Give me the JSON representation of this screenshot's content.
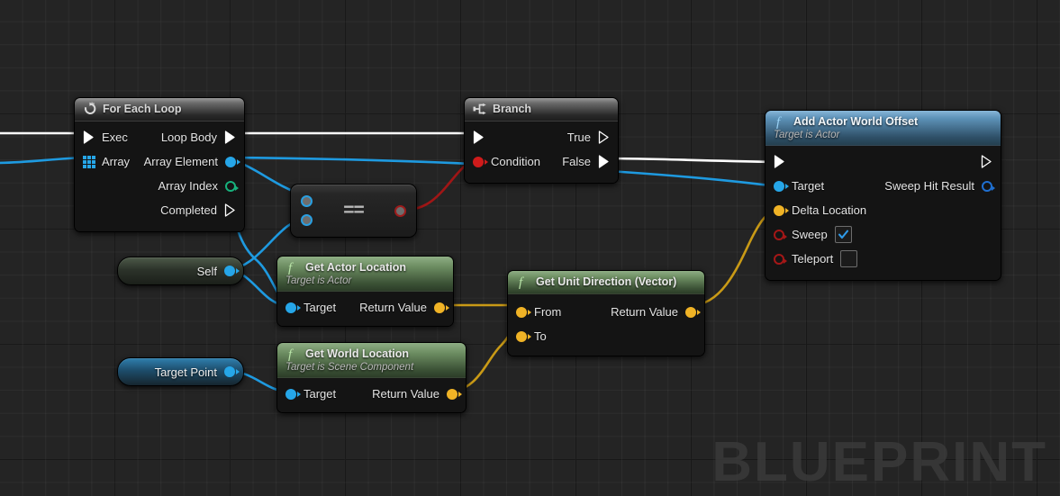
{
  "canvas": {
    "watermark": "BLUEPRINT",
    "background_color": "#242424",
    "grid_color": "#2e2e2e"
  },
  "colors": {
    "exec_white": "#ffffff",
    "object_blue": "#26a6e8",
    "vector_yellow": "#f0b326",
    "bool_red": "#cf1b1b",
    "int_green": "#17b17c",
    "struct_blue": "#1f6fd0"
  },
  "nodes": {
    "for_each_loop": {
      "title": "For Each Loop",
      "icon": "loop-icon",
      "header_style": "grey",
      "inputs": [
        {
          "label": "Exec",
          "pin": "exec-pin",
          "connected": true
        },
        {
          "label": "Array",
          "pin": "array-pin",
          "connected": true
        }
      ],
      "outputs": [
        {
          "label": "Loop Body",
          "pin": "exec-pin",
          "connected": true
        },
        {
          "label": "Array Element",
          "pin": "object-pin",
          "connected": true
        },
        {
          "label": "Array Index",
          "pin": "int-pin",
          "connected": false
        },
        {
          "label": "Completed",
          "pin": "exec-pin",
          "connected": false
        }
      ]
    },
    "branch": {
      "title": "Branch",
      "icon": "branch-icon",
      "header_style": "grey",
      "inputs": [
        {
          "label": "",
          "pin": "exec-pin",
          "connected": true
        },
        {
          "label": "Condition",
          "pin": "bool-pin",
          "connected": true
        }
      ],
      "outputs": [
        {
          "label": "True",
          "pin": "exec-pin",
          "connected": false
        },
        {
          "label": "False",
          "pin": "exec-pin",
          "connected": true
        }
      ]
    },
    "add_actor_world_offset": {
      "title": "Add Actor World Offset",
      "subtitle": "Target is Actor",
      "icon": "function-icon",
      "header_style": "blue",
      "inputs": [
        {
          "label": "",
          "pin": "exec-pin",
          "connected": true
        },
        {
          "label": "Target",
          "pin": "object-pin",
          "connected": true
        },
        {
          "label": "Delta Location",
          "pin": "vector-pin",
          "connected": true
        },
        {
          "label": "Sweep",
          "pin": "bool-pin",
          "connected": false,
          "checkbox": true,
          "checked": true
        },
        {
          "label": "Teleport",
          "pin": "bool-pin",
          "connected": false,
          "checkbox": true,
          "checked": false
        }
      ],
      "outputs": [
        {
          "label": "",
          "pin": "exec-pin",
          "connected": false
        },
        {
          "label": "Sweep Hit Result",
          "pin": "struct-pin",
          "connected": false
        }
      ]
    },
    "get_actor_location": {
      "title": "Get Actor Location",
      "subtitle": "Target is Actor",
      "icon": "function-icon",
      "header_style": "green",
      "inputs": [
        {
          "label": "Target",
          "pin": "object-pin",
          "connected": true
        }
      ],
      "outputs": [
        {
          "label": "Return Value",
          "pin": "vector-pin",
          "connected": true
        }
      ]
    },
    "get_world_location": {
      "title": "Get World Location",
      "subtitle": "Target is Scene Component",
      "icon": "function-icon",
      "header_style": "green",
      "inputs": [
        {
          "label": "Target",
          "pin": "object-pin",
          "connected": true
        }
      ],
      "outputs": [
        {
          "label": "Return Value",
          "pin": "vector-pin",
          "connected": true
        }
      ]
    },
    "get_unit_direction": {
      "title": "Get Unit Direction (Vector)",
      "icon": "function-icon",
      "header_style": "green",
      "inputs": [
        {
          "label": "From",
          "pin": "vector-pin",
          "connected": true
        },
        {
          "label": "To",
          "pin": "vector-pin",
          "connected": true
        }
      ],
      "outputs": [
        {
          "label": "Return Value",
          "pin": "vector-pin",
          "connected": true
        }
      ]
    },
    "equals": {
      "title": "==",
      "inputs": [
        {
          "label": "",
          "pin": "wildcard-pin",
          "connected": true
        },
        {
          "label": "",
          "pin": "wildcard-pin",
          "connected": true
        }
      ],
      "outputs": [
        {
          "label": "",
          "pin": "bool-pin",
          "connected": true
        }
      ]
    },
    "self_var": {
      "label": "Self",
      "pin": "object-pin",
      "connected": true
    },
    "target_point_var": {
      "label": "Target Point",
      "pin": "object-pin",
      "connected": true
    }
  }
}
